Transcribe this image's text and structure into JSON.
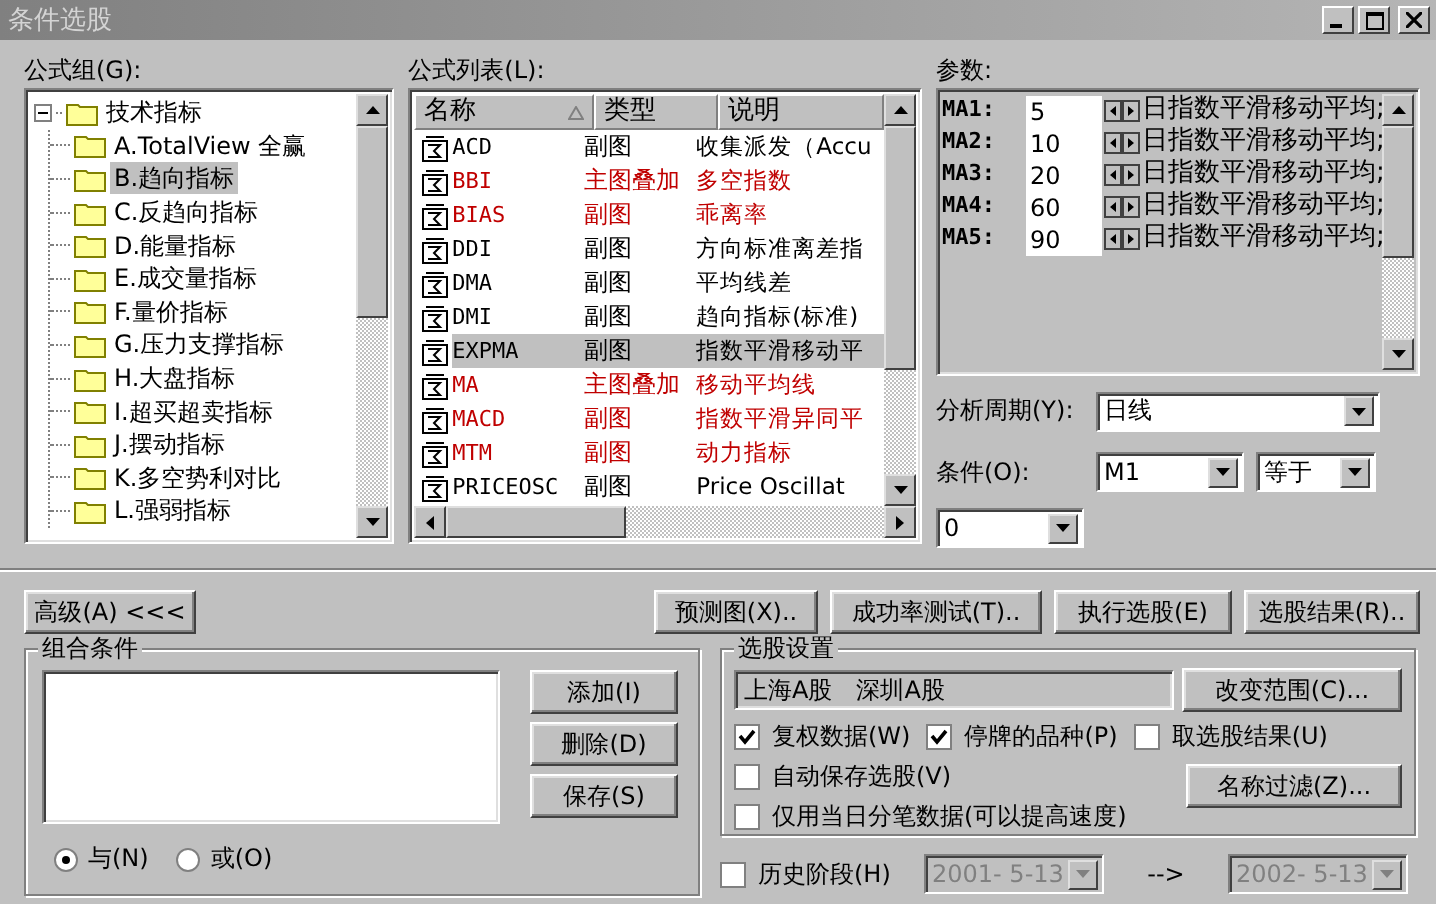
{
  "window": {
    "title": "条件选股"
  },
  "formula_group": {
    "label": "公式组(G):",
    "tree": {
      "label": "技术指标",
      "expanded": true,
      "children": [
        {
          "label": "A.TotalView 全赢",
          "selected": false
        },
        {
          "label": "B.趋向指标",
          "selected": true
        },
        {
          "label": "C.反趋向指标",
          "selected": false
        },
        {
          "label": "D.能量指标",
          "selected": false
        },
        {
          "label": "E.成交量指标",
          "selected": false
        },
        {
          "label": "F.量价指标",
          "selected": false
        },
        {
          "label": "G.压力支撑指标",
          "selected": false
        },
        {
          "label": "H.大盘指标",
          "selected": false
        },
        {
          "label": "I.超买超卖指标",
          "selected": false
        },
        {
          "label": "J.摆动指标",
          "selected": false
        },
        {
          "label": "K.多空势利对比",
          "selected": false
        },
        {
          "label": "L.强弱指标",
          "selected": false
        }
      ]
    }
  },
  "formula_list": {
    "label": "公式列表(L):",
    "columns": [
      "名称",
      "类型",
      "说明"
    ],
    "rows": [
      {
        "name": "ACD",
        "type": "副图",
        "description": "收集派发（Accu",
        "color": "#000000",
        "selected": false
      },
      {
        "name": "BBI",
        "type": "主图叠加",
        "description": "多空指数",
        "color": "#c00000",
        "selected": false
      },
      {
        "name": "BIAS",
        "type": "副图",
        "description": "乖离率",
        "color": "#c00000",
        "selected": false
      },
      {
        "name": "DDI",
        "type": "副图",
        "description": "方向标准离差指",
        "color": "#000000",
        "selected": false
      },
      {
        "name": "DMA",
        "type": "副图",
        "description": "平均线差",
        "color": "#000000",
        "selected": false
      },
      {
        "name": "DMI",
        "type": "副图",
        "description": "趋向指标(标准)",
        "color": "#000000",
        "selected": false
      },
      {
        "name": "EXPMA",
        "type": "副图",
        "description": "指数平滑移动平",
        "color": "#000000",
        "selected": true
      },
      {
        "name": "MA",
        "type": "主图叠加",
        "description": "移动平均线",
        "color": "#c00000",
        "selected": false
      },
      {
        "name": "MACD",
        "type": "副图",
        "description": "指数平滑异同平",
        "color": "#c00000",
        "selected": false
      },
      {
        "name": "MTM",
        "type": "副图",
        "description": "动力指标",
        "color": "#c00000",
        "selected": false
      },
      {
        "name": "PRICEOSC",
        "type": "副图",
        "description": "Price Oscillat",
        "color": "#000000",
        "selected": false
      }
    ]
  },
  "params": {
    "label": "参数:",
    "rows": [
      {
        "label": "MA1:",
        "value": "5",
        "unit": "日指数平滑移动平均;"
      },
      {
        "label": "MA2:",
        "value": "10",
        "unit": "日指数平滑移动平均;"
      },
      {
        "label": "MA3:",
        "value": "20",
        "unit": "日指数平滑移动平均;"
      },
      {
        "label": "MA4:",
        "value": "60",
        "unit": "日指数平滑移动平均;"
      },
      {
        "label": "MA5:",
        "value": "90",
        "unit": "日指数平滑移动平均;"
      }
    ]
  },
  "period": {
    "label": "分析周期(Y):",
    "value": "日线"
  },
  "condition": {
    "label": "条件(O):",
    "operand": "M1",
    "operator": "等于",
    "value": "0"
  },
  "action_buttons": [
    {
      "label": "高级(A) <<<"
    },
    {
      "label": "预测图(X).."
    },
    {
      "label": "成功率测试(T).."
    },
    {
      "label": "执行选股(E)"
    },
    {
      "label": "选股结果(R).."
    }
  ],
  "combination": {
    "title": "组合条件",
    "buttons": [
      "添加(I)",
      "删除(D)",
      "保存(S)"
    ],
    "logic": [
      {
        "label": "与(N)",
        "selected": true
      },
      {
        "label": "或(O)",
        "selected": false
      }
    ]
  },
  "settings": {
    "title": "选股设置",
    "range": "上海A股　深圳A股",
    "range_button": "改变范围(C)...",
    "filter_button": "名称过滤(Z)...",
    "options": [
      {
        "label": "复权数据(W)",
        "checked": true
      },
      {
        "label": "停牌的品种(P)",
        "checked": true
      },
      {
        "label": "取选股结果(U)",
        "checked": false
      },
      {
        "label": "自动保存选股(V)",
        "checked": false
      },
      {
        "label": "仅用当日分笔数据(可以提高速度)",
        "checked": false
      }
    ]
  },
  "history": {
    "label": "历史阶段(H)",
    "checked": false,
    "arrow": "-->",
    "from": {
      "value": "2001- 5-13",
      "disabled": true
    },
    "to": {
      "value": "2002- 5-13",
      "disabled": true
    }
  }
}
